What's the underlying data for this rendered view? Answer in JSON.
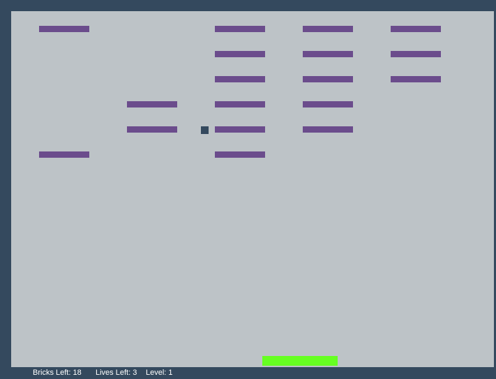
{
  "colors": {
    "frame": "#34495e",
    "playfield": "#bdc3c7",
    "brick": "#6b4c8c",
    "ball": "#34495e",
    "paddle": "#66ff22",
    "status_text": "#ffffff"
  },
  "bricks": [
    {
      "col": 0,
      "row": 0
    },
    {
      "col": 2,
      "row": 0
    },
    {
      "col": 3,
      "row": 0
    },
    {
      "col": 4,
      "row": 0
    },
    {
      "col": 2,
      "row": 1
    },
    {
      "col": 3,
      "row": 1
    },
    {
      "col": 4,
      "row": 1
    },
    {
      "col": 2,
      "row": 2
    },
    {
      "col": 3,
      "row": 2
    },
    {
      "col": 4,
      "row": 2
    },
    {
      "col": 1,
      "row": 3
    },
    {
      "col": 2,
      "row": 3
    },
    {
      "col": 3,
      "row": 3
    },
    {
      "col": 1,
      "row": 4
    },
    {
      "col": 2,
      "row": 4
    },
    {
      "col": 3,
      "row": 4
    },
    {
      "col": 0,
      "row": 5
    },
    {
      "col": 2,
      "row": 5
    }
  ],
  "status": {
    "bricks_label": "Bricks Left:",
    "bricks_left": "18",
    "lives_label": "Lives Left:",
    "lives_left": "3",
    "level_label": "Level:",
    "level": "1"
  }
}
